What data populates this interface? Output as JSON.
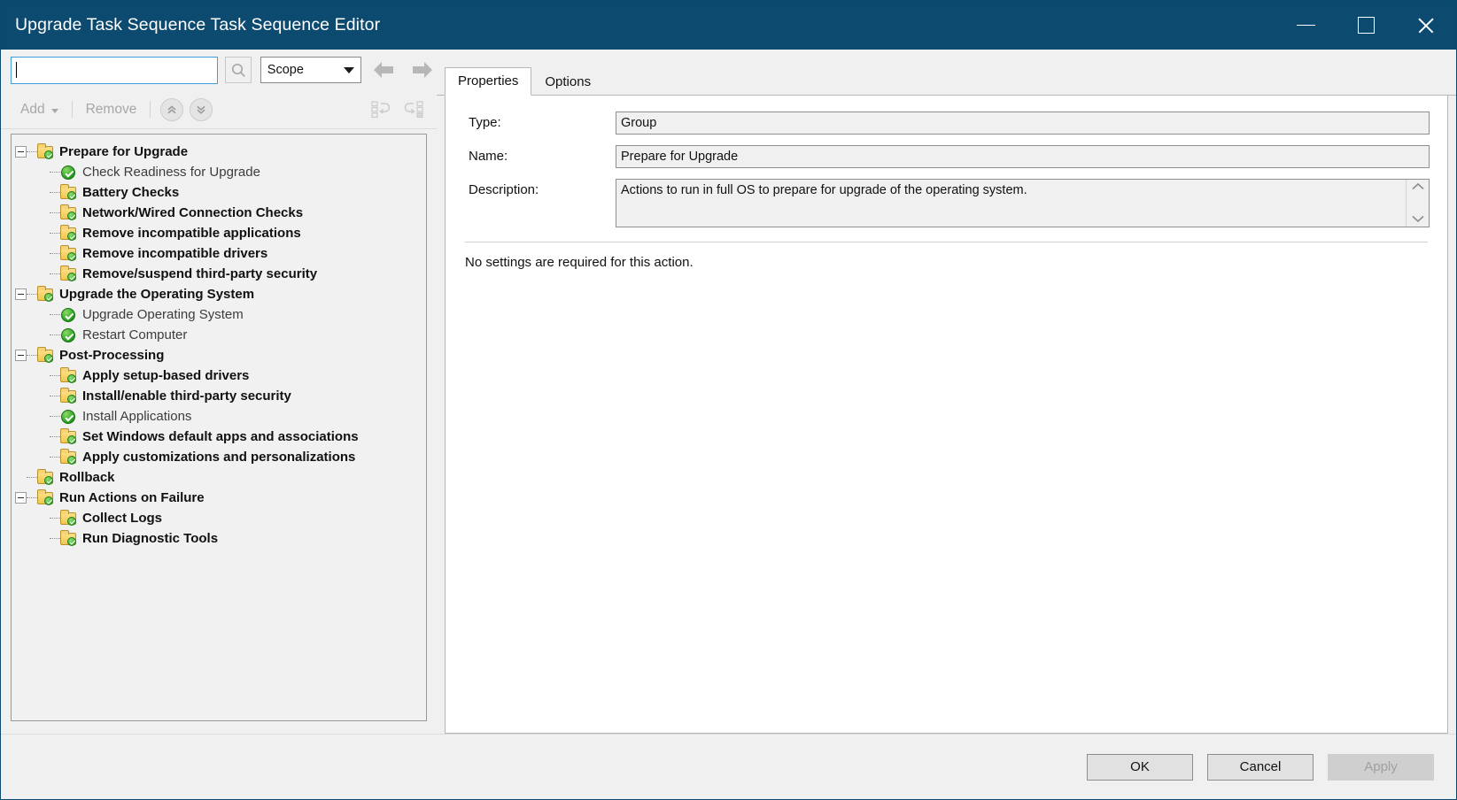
{
  "window": {
    "title": "Upgrade Task Sequence Task Sequence Editor",
    "minimize_label": "Minimize",
    "maximize_label": "Maximize",
    "close_label": "Close"
  },
  "search": {
    "value": "",
    "placeholder": "",
    "search_icon": "magnifier-icon",
    "scope_selected": "Scope",
    "scope_options": [
      "Scope"
    ],
    "back_label": "Back",
    "forward_label": "Forward"
  },
  "toolbar": {
    "add_label": "Add",
    "remove_label": "Remove",
    "move_up_label": "Move Up",
    "move_down_label": "Move Down",
    "collapse_all_label": "Collapse All",
    "expand_all_label": "Expand All"
  },
  "tree": [
    {
      "label": "Prepare for Upgrade",
      "kind": "group",
      "depth": 0,
      "expander": "minus"
    },
    {
      "label": "Check Readiness for Upgrade",
      "kind": "action",
      "depth": 1,
      "expander": "none"
    },
    {
      "label": "Battery Checks",
      "kind": "group",
      "depth": 1,
      "expander": "none"
    },
    {
      "label": "Network/Wired Connection Checks",
      "kind": "group",
      "depth": 1,
      "expander": "none"
    },
    {
      "label": "Remove incompatible applications",
      "kind": "group",
      "depth": 1,
      "expander": "none"
    },
    {
      "label": "Remove incompatible drivers",
      "kind": "group",
      "depth": 1,
      "expander": "none"
    },
    {
      "label": "Remove/suspend third-party security",
      "kind": "group",
      "depth": 1,
      "expander": "none"
    },
    {
      "label": "Upgrade the Operating System",
      "kind": "group",
      "depth": 0,
      "expander": "minus"
    },
    {
      "label": "Upgrade Operating System",
      "kind": "action",
      "depth": 1,
      "expander": "none"
    },
    {
      "label": "Restart Computer",
      "kind": "action",
      "depth": 1,
      "expander": "none"
    },
    {
      "label": "Post-Processing",
      "kind": "group",
      "depth": 0,
      "expander": "minus"
    },
    {
      "label": "Apply setup-based drivers",
      "kind": "group",
      "depth": 1,
      "expander": "none"
    },
    {
      "label": "Install/enable third-party security",
      "kind": "group",
      "depth": 1,
      "expander": "none"
    },
    {
      "label": "Install Applications",
      "kind": "action",
      "depth": 1,
      "expander": "none"
    },
    {
      "label": "Set Windows default apps and associations",
      "kind": "group",
      "depth": 1,
      "expander": "none"
    },
    {
      "label": "Apply customizations and personalizations",
      "kind": "group",
      "depth": 1,
      "expander": "none"
    },
    {
      "label": "Rollback",
      "kind": "group",
      "depth": 0,
      "expander": "none"
    },
    {
      "label": "Run Actions on Failure",
      "kind": "group",
      "depth": 0,
      "expander": "minus"
    },
    {
      "label": "Collect Logs",
      "kind": "group",
      "depth": 1,
      "expander": "none"
    },
    {
      "label": "Run Diagnostic Tools",
      "kind": "group",
      "depth": 1,
      "expander": "none"
    }
  ],
  "tabs": [
    {
      "label": "Properties",
      "active": true
    },
    {
      "label": "Options",
      "active": false
    }
  ],
  "properties": {
    "type_label": "Type:",
    "type_value": "Group",
    "name_label": "Name:",
    "name_value": "Prepare for Upgrade",
    "description_label": "Description:",
    "description_value": "Actions to run in full OS to prepare for upgrade of the operating system.",
    "scroll_up_glyph": "⌃",
    "scroll_down_glyph": "⌄",
    "note": "No settings are required  for this action."
  },
  "footer": {
    "ok_label": "OK",
    "cancel_label": "Cancel",
    "apply_label": "Apply"
  },
  "colors": {
    "titlebar": "#0d4a70",
    "accent": "#3f9fd9",
    "folder": "#f3c64c",
    "check_green": "#219a1d"
  }
}
